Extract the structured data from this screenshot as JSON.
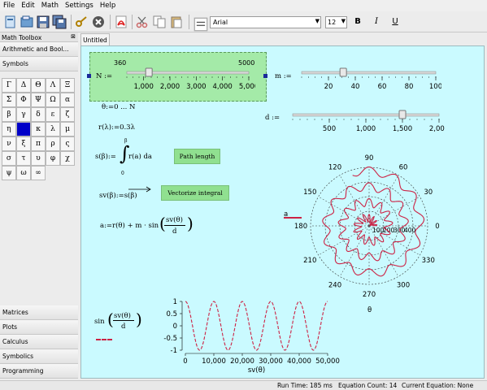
{
  "menu": [
    "File",
    "Edit",
    "Math",
    "Settings",
    "Help"
  ],
  "toolbar": {
    "icons": [
      "new-file-icon",
      "open-icon",
      "save-icon",
      "save-all-icon",
      "key-icon",
      "stop-icon",
      "pdf-icon",
      "cut-icon",
      "copy-icon",
      "paste-icon"
    ],
    "font": "Arial",
    "size": "12",
    "bold": "B",
    "italic": "I",
    "underline": "U"
  },
  "toolbox": {
    "title": "Math Toolbox",
    "sections_top": [
      "Arithmetic and Bool...",
      "Symbols"
    ],
    "symbols": [
      "Γ",
      "Δ",
      "Θ",
      "Λ",
      "Ξ",
      "Σ",
      "Φ",
      "Ψ",
      "Ω",
      "α",
      "β",
      "γ",
      "δ",
      "ε",
      "ζ",
      "η",
      "■",
      "κ",
      "λ",
      "μ",
      "ν",
      "ξ",
      "π",
      "ρ",
      "ς",
      "σ",
      "τ",
      "υ",
      "φ",
      "χ",
      "ψ",
      "ω",
      "∞"
    ],
    "sections_bottom": [
      "Matrices",
      "Plots",
      "Calculus",
      "Symbolics",
      "Programming"
    ]
  },
  "document": {
    "tab": "Untitled",
    "slider_N": {
      "label": "N :=",
      "min_label": "360",
      "max_label": "5000",
      "ticks": [
        "1,000",
        "2,000",
        "3,000",
        "4,000",
        "5,000"
      ],
      "value": 1200
    },
    "slider_m": {
      "label": "m :=",
      "ticks": [
        "20",
        "40",
        "60",
        "80",
        "100"
      ],
      "value": 31
    },
    "slider_d": {
      "label": "d :=",
      "ticks": [
        "500",
        "1,000",
        "1,500",
        "2,000"
      ],
      "value": 1500
    },
    "eq_theta": "θ:=0 ... N",
    "eq_r": "r(λ):=0.3λ",
    "eq_s_lhs": "s(β):=",
    "eq_s_int": "∫",
    "eq_s_upper": "β",
    "eq_s_lower": "0",
    "eq_s_rhs": "r(a)  da",
    "btn_path": "Path length",
    "eq_sv": "sv(β):=s(β)",
    "btn_vec": "Vectorize integral",
    "eq_a_lhs": "a:=r(θ) + m · sin",
    "eq_a_num": "sv(θ)",
    "eq_a_den": "d",
    "plot_label": "sin",
    "plot_num": "sv(θ)",
    "plot_den": "d",
    "legend_a": "a",
    "polar_xlabel": "θ"
  },
  "chart_data": [
    {
      "type": "polar",
      "angle_ticks": [
        "0",
        "30",
        "60",
        "90",
        "120",
        "150",
        "180",
        "210",
        "240",
        "270",
        "300",
        "330"
      ],
      "radial_ticks": [
        "100",
        "200",
        "300",
        "400"
      ],
      "series": [
        {
          "name": "a",
          "color": "#cc2244"
        }
      ]
    },
    {
      "type": "line",
      "xlabel": "sv(θ)",
      "x_ticks": [
        "0",
        "10,000",
        "20,000",
        "30,000",
        "40,000",
        "50,000"
      ],
      "y_ticks": [
        "1",
        "0.5",
        "0",
        "-0.5",
        "-1"
      ],
      "xlim": [
        0,
        50000
      ],
      "ylim": [
        -1,
        1
      ],
      "cycles": 5,
      "series": [
        {
          "color": "#cc2244"
        }
      ]
    }
  ],
  "status": {
    "run_time": "Run Time: 185 ms",
    "eq_count": "Equation Count: 14",
    "current": "Current Equation: None"
  },
  "colors": {
    "canvas": "#cafaff",
    "accent_red": "#cc2244",
    "button_green": "#90e090"
  }
}
